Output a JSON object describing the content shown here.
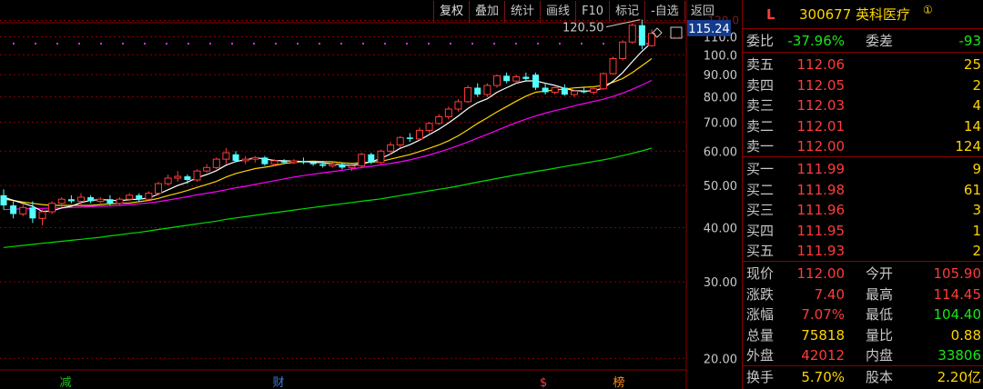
{
  "toolbar": {
    "items": [
      "复权",
      "叠加",
      "统计",
      "画线",
      "F10",
      "标记",
      "-自选",
      "返回"
    ]
  },
  "chart": {
    "current_price_tag": "115.24",
    "high_annotation": "120.50",
    "y_axis_ticks": [
      "110.0",
      "100.0",
      "90.00",
      "80.00",
      "70.00",
      "60.00",
      "50.00",
      "40.00",
      "30.00",
      "20.00"
    ],
    "top_tick_partial": "120.0",
    "event_markers": [
      {
        "text": "减",
        "color": "#1fbf1f"
      },
      {
        "text": "财",
        "color": "#3a7bd5"
      },
      {
        "text": "$",
        "color": "#ff3b3b"
      },
      {
        "text": "榜",
        "color": "#ff8c1a"
      }
    ],
    "colors": {
      "up": "#ff3b3b",
      "down": "#54ffff",
      "ma5": "#ffffff",
      "ma10": "#ffd400",
      "ma20": "#ff00ff",
      "ma60": "#00dd00",
      "grid": "#8b0000"
    }
  },
  "chart_data": {
    "type": "candlestick",
    "y_scale": "log",
    "ylim": [
      17,
      125
    ],
    "candles": [
      {
        "o": 47.5,
        "h": 49.0,
        "l": 44.0,
        "c": 45.0
      },
      {
        "o": 45.0,
        "h": 46.0,
        "l": 42.0,
        "c": 43.0
      },
      {
        "o": 43.0,
        "h": 45.5,
        "l": 42.5,
        "c": 44.5
      },
      {
        "o": 44.5,
        "h": 46.0,
        "l": 41.0,
        "c": 42.0
      },
      {
        "o": 42.0,
        "h": 44.0,
        "l": 40.5,
        "c": 43.5
      },
      {
        "o": 43.5,
        "h": 46.0,
        "l": 43.0,
        "c": 45.5
      },
      {
        "o": 45.5,
        "h": 47.0,
        "l": 44.5,
        "c": 46.5
      },
      {
        "o": 46.5,
        "h": 47.5,
        "l": 45.5,
        "c": 46.0
      },
      {
        "o": 46.0,
        "h": 48.0,
        "l": 45.0,
        "c": 47.0
      },
      {
        "o": 47.0,
        "h": 47.5,
        "l": 45.5,
        "c": 46.0
      },
      {
        "o": 46.0,
        "h": 47.0,
        "l": 45.5,
        "c": 46.5
      },
      {
        "o": 46.5,
        "h": 47.5,
        "l": 45.0,
        "c": 45.5
      },
      {
        "o": 45.5,
        "h": 47.0,
        "l": 45.0,
        "c": 46.5
      },
      {
        "o": 46.5,
        "h": 48.0,
        "l": 46.0,
        "c": 47.5
      },
      {
        "o": 47.5,
        "h": 48.0,
        "l": 46.0,
        "c": 46.5
      },
      {
        "o": 46.5,
        "h": 48.5,
        "l": 46.0,
        "c": 48.0
      },
      {
        "o": 48.0,
        "h": 51.0,
        "l": 47.5,
        "c": 50.5
      },
      {
        "o": 50.5,
        "h": 53.0,
        "l": 50.0,
        "c": 52.0
      },
      {
        "o": 52.0,
        "h": 54.0,
        "l": 51.0,
        "c": 52.5
      },
      {
        "o": 52.5,
        "h": 53.0,
        "l": 50.5,
        "c": 51.5
      },
      {
        "o": 51.5,
        "h": 54.5,
        "l": 51.0,
        "c": 54.0
      },
      {
        "o": 54.0,
        "h": 56.0,
        "l": 53.5,
        "c": 55.0
      },
      {
        "o": 55.0,
        "h": 58.0,
        "l": 54.5,
        "c": 57.5
      },
      {
        "o": 57.5,
        "h": 61.0,
        "l": 56.0,
        "c": 59.5
      },
      {
        "o": 59.0,
        "h": 60.0,
        "l": 56.5,
        "c": 57.0
      },
      {
        "o": 57.0,
        "h": 58.5,
        "l": 56.0,
        "c": 57.5
      },
      {
        "o": 57.5,
        "h": 58.5,
        "l": 56.5,
        "c": 58.0
      },
      {
        "o": 58.0,
        "h": 58.5,
        "l": 55.5,
        "c": 56.0
      },
      {
        "o": 56.0,
        "h": 57.5,
        "l": 55.5,
        "c": 57.0
      },
      {
        "o": 57.0,
        "h": 57.5,
        "l": 56.0,
        "c": 56.5
      },
      {
        "o": 56.5,
        "h": 57.5,
        "l": 56.0,
        "c": 57.0
      },
      {
        "o": 57.0,
        "h": 58.0,
        "l": 56.0,
        "c": 56.5
      },
      {
        "o": 56.5,
        "h": 57.0,
        "l": 55.5,
        "c": 56.0
      },
      {
        "o": 56.0,
        "h": 57.0,
        "l": 55.0,
        "c": 55.5
      },
      {
        "o": 55.5,
        "h": 56.5,
        "l": 55.0,
        "c": 56.0
      },
      {
        "o": 56.0,
        "h": 56.5,
        "l": 54.5,
        "c": 55.0
      },
      {
        "o": 55.0,
        "h": 56.0,
        "l": 54.0,
        "c": 55.5
      },
      {
        "o": 55.5,
        "h": 59.5,
        "l": 55.0,
        "c": 59.0
      },
      {
        "o": 59.0,
        "h": 59.5,
        "l": 56.0,
        "c": 56.5
      },
      {
        "o": 56.5,
        "h": 60.5,
        "l": 56.0,
        "c": 60.0
      },
      {
        "o": 60.0,
        "h": 63.0,
        "l": 59.0,
        "c": 62.0
      },
      {
        "o": 62.0,
        "h": 65.0,
        "l": 61.0,
        "c": 64.5
      },
      {
        "o": 64.5,
        "h": 66.0,
        "l": 63.0,
        "c": 64.0
      },
      {
        "o": 64.0,
        "h": 68.0,
        "l": 63.5,
        "c": 67.0
      },
      {
        "o": 67.0,
        "h": 70.0,
        "l": 66.0,
        "c": 69.5
      },
      {
        "o": 69.5,
        "h": 73.0,
        "l": 69.0,
        "c": 72.0
      },
      {
        "o": 72.0,
        "h": 76.0,
        "l": 71.0,
        "c": 75.0
      },
      {
        "o": 75.0,
        "h": 79.0,
        "l": 74.0,
        "c": 78.0
      },
      {
        "o": 78.0,
        "h": 85.0,
        "l": 77.5,
        "c": 84.0
      },
      {
        "o": 84.0,
        "h": 86.0,
        "l": 80.0,
        "c": 81.0
      },
      {
        "o": 81.0,
        "h": 86.0,
        "l": 80.0,
        "c": 85.0
      },
      {
        "o": 85.0,
        "h": 90.0,
        "l": 84.0,
        "c": 89.5
      },
      {
        "o": 89.5,
        "h": 91.0,
        "l": 86.0,
        "c": 87.0
      },
      {
        "o": 87.0,
        "h": 90.0,
        "l": 86.0,
        "c": 89.0
      },
      {
        "o": 89.0,
        "h": 91.0,
        "l": 87.0,
        "c": 88.0
      },
      {
        "o": 90.0,
        "h": 91.0,
        "l": 83.0,
        "c": 84.0
      },
      {
        "o": 84.0,
        "h": 86.0,
        "l": 81.0,
        "c": 82.0
      },
      {
        "o": 82.0,
        "h": 85.0,
        "l": 81.0,
        "c": 84.0
      },
      {
        "o": 84.0,
        "h": 85.5,
        "l": 80.5,
        "c": 81.0
      },
      {
        "o": 81.0,
        "h": 83.0,
        "l": 80.0,
        "c": 82.5
      },
      {
        "o": 82.5,
        "h": 84.0,
        "l": 81.5,
        "c": 82.0
      },
      {
        "o": 82.0,
        "h": 84.0,
        "l": 81.0,
        "c": 83.5
      },
      {
        "o": 83.5,
        "h": 91.0,
        "l": 83.0,
        "c": 90.5
      },
      {
        "o": 90.5,
        "h": 99.0,
        "l": 90.0,
        "c": 98.0
      },
      {
        "o": 98.0,
        "h": 108.0,
        "l": 97.0,
        "c": 107.0
      },
      {
        "o": 107.0,
        "h": 118.0,
        "l": 106.0,
        "c": 117.0
      },
      {
        "o": 117.0,
        "h": 120.5,
        "l": 103.0,
        "c": 105.0
      },
      {
        "o": 105.0,
        "h": 114.5,
        "l": 104.4,
        "c": 112.0
      }
    ],
    "ma5": [
      47.0,
      46.2,
      45.5,
      44.8,
      43.6,
      43.7,
      44.4,
      44.8,
      45.7,
      46.2,
      46.4,
      46.3,
      46.1,
      46.4,
      46.5,
      46.8,
      47.8,
      48.9,
      50.0,
      50.9,
      52.1,
      53.0,
      54.1,
      55.7,
      56.8,
      57.3,
      57.9,
      57.6,
      57.1,
      57.0,
      56.9,
      56.8,
      56.6,
      56.4,
      56.1,
      55.8,
      55.6,
      56.1,
      56.7,
      57.7,
      59.1,
      60.9,
      62.1,
      63.6,
      65.5,
      67.4,
      69.7,
      72.3,
      75.2,
      77.6,
      79.2,
      82.0,
      84.0,
      86.0,
      87.1,
      87.1,
      86.0,
      85.0,
      83.7,
      82.7,
      82.5,
      82.6,
      83.8,
      86.9,
      91.0,
      96.4,
      101.9,
      106.8
    ],
    "ma10": [
      46.5,
      46.2,
      45.8,
      45.5,
      45.2,
      45.0,
      45.0,
      45.0,
      45.0,
      45.0,
      45.2,
      45.4,
      45.5,
      45.6,
      45.9,
      46.2,
      46.7,
      47.4,
      48.0,
      48.7,
      49.5,
      50.3,
      51.1,
      52.3,
      53.3,
      54.0,
      54.7,
      55.1,
      55.6,
      56.2,
      56.5,
      56.8,
      56.9,
      56.8,
      56.7,
      56.4,
      56.2,
      56.4,
      56.6,
      56.8,
      57.5,
      58.2,
      58.9,
      59.9,
      60.9,
      62.0,
      63.4,
      65.1,
      67.2,
      69.5,
      71.6,
      73.9,
      76.0,
      78.2,
      80.3,
      82.0,
      82.5,
      83.0,
      83.4,
      83.9,
      84.2,
      84.4,
      85.1,
      86.4,
      88.2,
      91.0,
      94.4,
      98.0
    ],
    "ma20": [
      44.0,
      44.1,
      44.2,
      44.3,
      44.3,
      44.4,
      44.4,
      44.5,
      44.6,
      44.7,
      44.8,
      44.9,
      45.0,
      45.2,
      45.4,
      45.6,
      45.9,
      46.3,
      46.7,
      47.1,
      47.6,
      48.0,
      48.4,
      48.9,
      49.4,
      49.8,
      50.3,
      50.8,
      51.3,
      51.8,
      52.3,
      52.7,
      53.1,
      53.5,
      53.8,
      54.2,
      54.6,
      55.0,
      55.4,
      55.8,
      56.2,
      56.7,
      57.3,
      58.0,
      58.8,
      59.7,
      60.7,
      61.8,
      63.0,
      64.3,
      65.6,
      67.0,
      68.4,
      69.8,
      71.1,
      72.3,
      73.4,
      74.4,
      75.3,
      76.3,
      77.2,
      78.1,
      79.0,
      80.2,
      81.6,
      83.3,
      85.2,
      87.3
    ],
    "ma60": [
      36.0,
      36.2,
      36.4,
      36.6,
      36.8,
      37.0,
      37.2,
      37.4,
      37.6,
      37.8,
      38.0,
      38.3,
      38.5,
      38.8,
      39.0,
      39.3,
      39.6,
      39.9,
      40.2,
      40.5,
      40.8,
      41.1,
      41.4,
      41.8,
      42.1,
      42.4,
      42.7,
      43.0,
      43.3,
      43.6,
      43.9,
      44.2,
      44.5,
      44.8,
      45.1,
      45.4,
      45.7,
      46.0,
      46.3,
      46.6,
      47.0,
      47.4,
      47.8,
      48.2,
      48.6,
      49.0,
      49.4,
      49.9,
      50.4,
      50.9,
      51.4,
      51.9,
      52.4,
      52.9,
      53.4,
      53.9,
      54.3,
      54.8,
      55.3,
      55.8,
      56.3,
      56.8,
      57.3,
      57.9,
      58.6,
      59.3,
      60.1,
      61.0
    ]
  },
  "quote_panel": {
    "market_flag": "L",
    "code": "300677",
    "name": "英科医疗",
    "badge": "①",
    "webi": {
      "label": "委比",
      "value": "-37.96%",
      "label2": "委差",
      "value2": "-93"
    },
    "asks": [
      {
        "label": "卖五",
        "price": "112.06",
        "qty": "25"
      },
      {
        "label": "卖四",
        "price": "112.05",
        "qty": "2"
      },
      {
        "label": "卖三",
        "price": "112.03",
        "qty": "4"
      },
      {
        "label": "卖二",
        "price": "112.01",
        "qty": "14"
      },
      {
        "label": "卖一",
        "price": "112.00",
        "qty": "124"
      }
    ],
    "bids": [
      {
        "label": "买一",
        "price": "111.99",
        "qty": "9"
      },
      {
        "label": "买二",
        "price": "111.98",
        "qty": "61"
      },
      {
        "label": "买三",
        "price": "111.96",
        "qty": "3"
      },
      {
        "label": "买四",
        "price": "111.95",
        "qty": "1"
      },
      {
        "label": "买五",
        "price": "111.93",
        "qty": "2"
      }
    ],
    "stats": [
      {
        "l1": "现价",
        "v1": "112.00",
        "c1": "red",
        "l2": "今开",
        "v2": "105.90",
        "c2": "red"
      },
      {
        "l1": "涨跌",
        "v1": "7.40",
        "c1": "red",
        "l2": "最高",
        "v2": "114.45",
        "c2": "red"
      },
      {
        "l1": "涨幅",
        "v1": "7.07%",
        "c1": "red",
        "l2": "最低",
        "v2": "104.40",
        "c2": "green"
      },
      {
        "l1": "总量",
        "v1": "75818",
        "c1": "yellow",
        "l2": "量比",
        "v2": "0.88",
        "c2": "yellow"
      },
      {
        "l1": "外盘",
        "v1": "42012",
        "c1": "red",
        "l2": "内盘",
        "v2": "33806",
        "c2": "green"
      }
    ],
    "turnover": {
      "l1": "换手",
      "v1": "5.70%",
      "l2": "股本",
      "v2": "2.20亿"
    }
  }
}
